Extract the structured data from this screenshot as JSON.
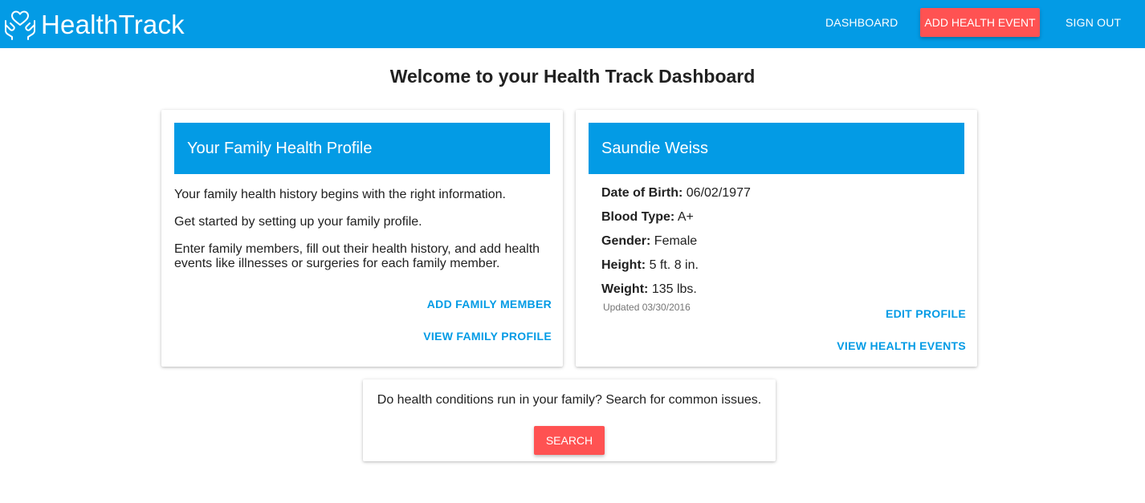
{
  "colors": {
    "primary": "#039be5",
    "accent": "#ff5252",
    "text": "#212121"
  },
  "brand": {
    "icon": "heart-hands-icon",
    "name": "HealthTrack"
  },
  "nav": {
    "dashboard": "DASHBOARD",
    "add_health_event": "ADD HEALTH EVENT",
    "sign_out": "SIGN OUT"
  },
  "page": {
    "title": "Welcome to your Health Track Dashboard"
  },
  "family_card": {
    "header": "Your Family Health Profile",
    "paragraphs": [
      "Your family health history begins with the right information.",
      "Get started by setting up your family profile.",
      "Enter family members, fill out their health history, and add health events like illnesses or surgeries for each family member."
    ],
    "add_family_member": "ADD FAMILY MEMBER",
    "view_family_profile": "VIEW FAMILY PROFILE"
  },
  "profile_card": {
    "header": "Saundie Weiss",
    "rows": [
      {
        "label": "Date of Birth:",
        "value": "06/02/1977"
      },
      {
        "label": "Blood Type:",
        "value": "A+"
      },
      {
        "label": "Gender:",
        "value": "Female"
      },
      {
        "label": "Height:",
        "value": "5 ft. 8 in."
      },
      {
        "label": "Weight:",
        "value": "135 lbs."
      }
    ],
    "updated": "Updated 03/30/2016",
    "edit_profile": "EDIT PROFILE",
    "view_health_events": "VIEW HEALTH EVENTS"
  },
  "search_card": {
    "text": "Do health conditions run in your family? Search for common issues.",
    "button": "SEARCH"
  }
}
